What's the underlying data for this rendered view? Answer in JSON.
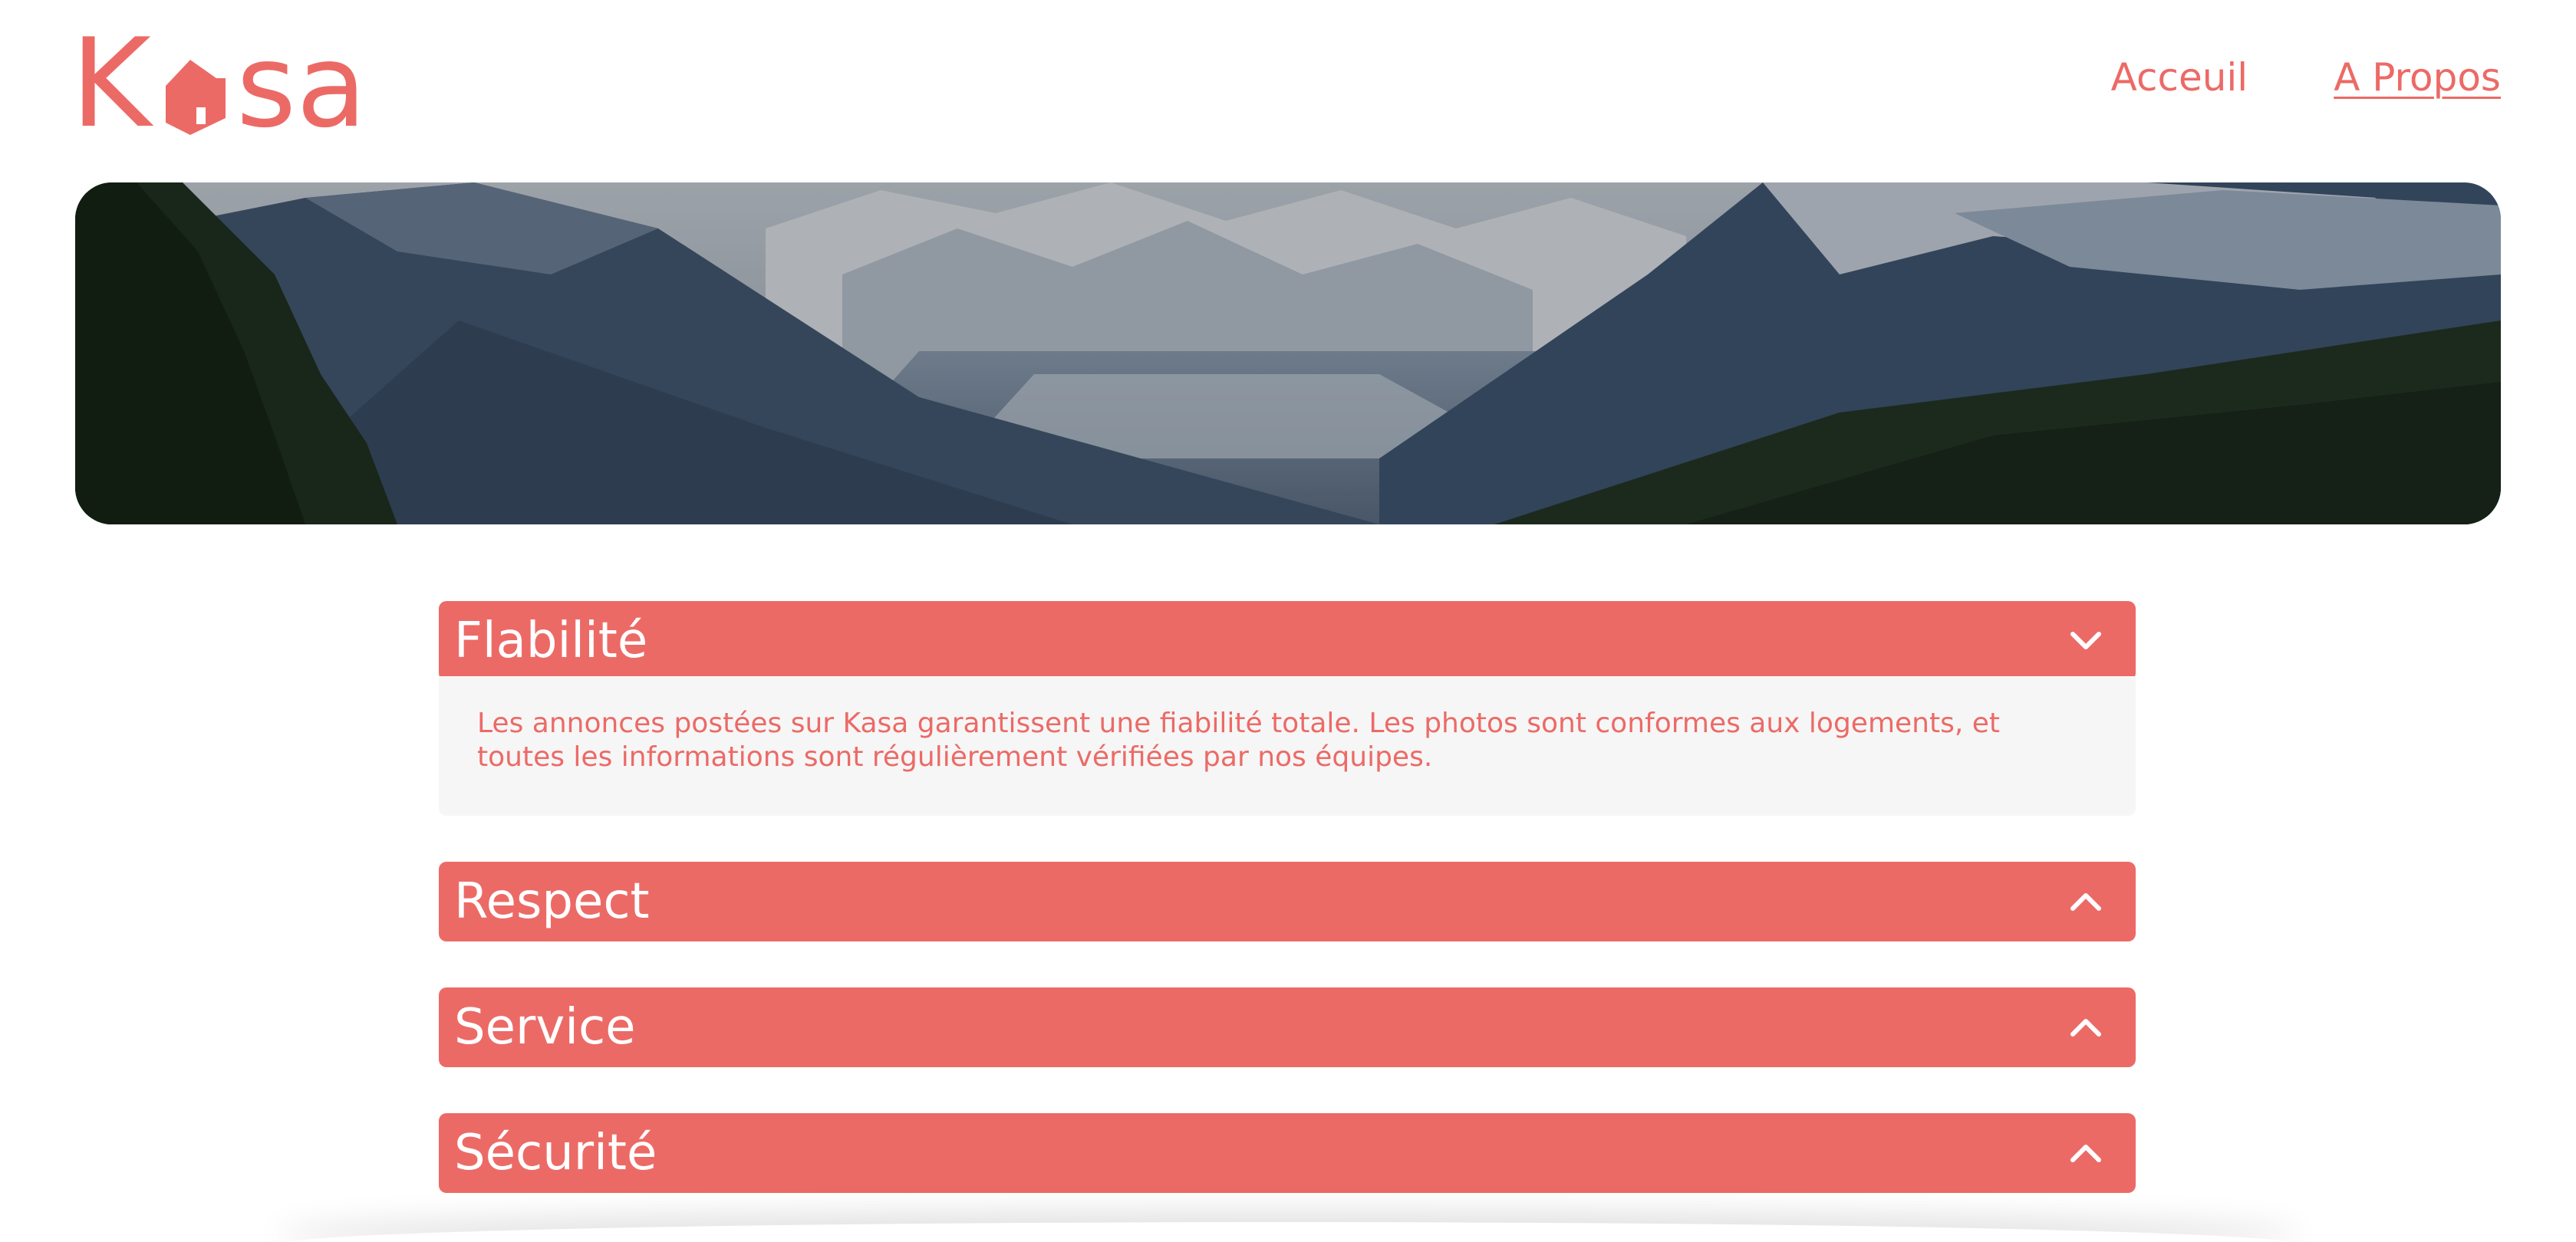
{
  "header": {
    "logo": {
      "text_left": "K",
      "text_right": "sa",
      "color": "#ec6a66"
    },
    "nav": [
      {
        "label": "Acceuil",
        "active": false
      },
      {
        "label": "A Propos",
        "active": true
      }
    ]
  },
  "banner": {
    "image": "mountain-valley-landscape"
  },
  "accordion": [
    {
      "title": "Flabilité",
      "expanded": true,
      "icon": "chevron-down-icon",
      "content": "Les annonces postées sur Kasa garantissent une fiabilité totale. Les photos sont conformes aux logements, et toutes les informations sont régulièrement vérifiées par nos équipes."
    },
    {
      "title": "Respect",
      "expanded": false,
      "icon": "chevron-up-icon"
    },
    {
      "title": "Service",
      "expanded": false,
      "icon": "chevron-up-icon"
    },
    {
      "title": "Sécurité",
      "expanded": false,
      "icon": "chevron-up-icon"
    }
  ],
  "colors": {
    "accent": "#ec6a66",
    "panel": "#f6f6f6",
    "white": "#ffffff"
  }
}
